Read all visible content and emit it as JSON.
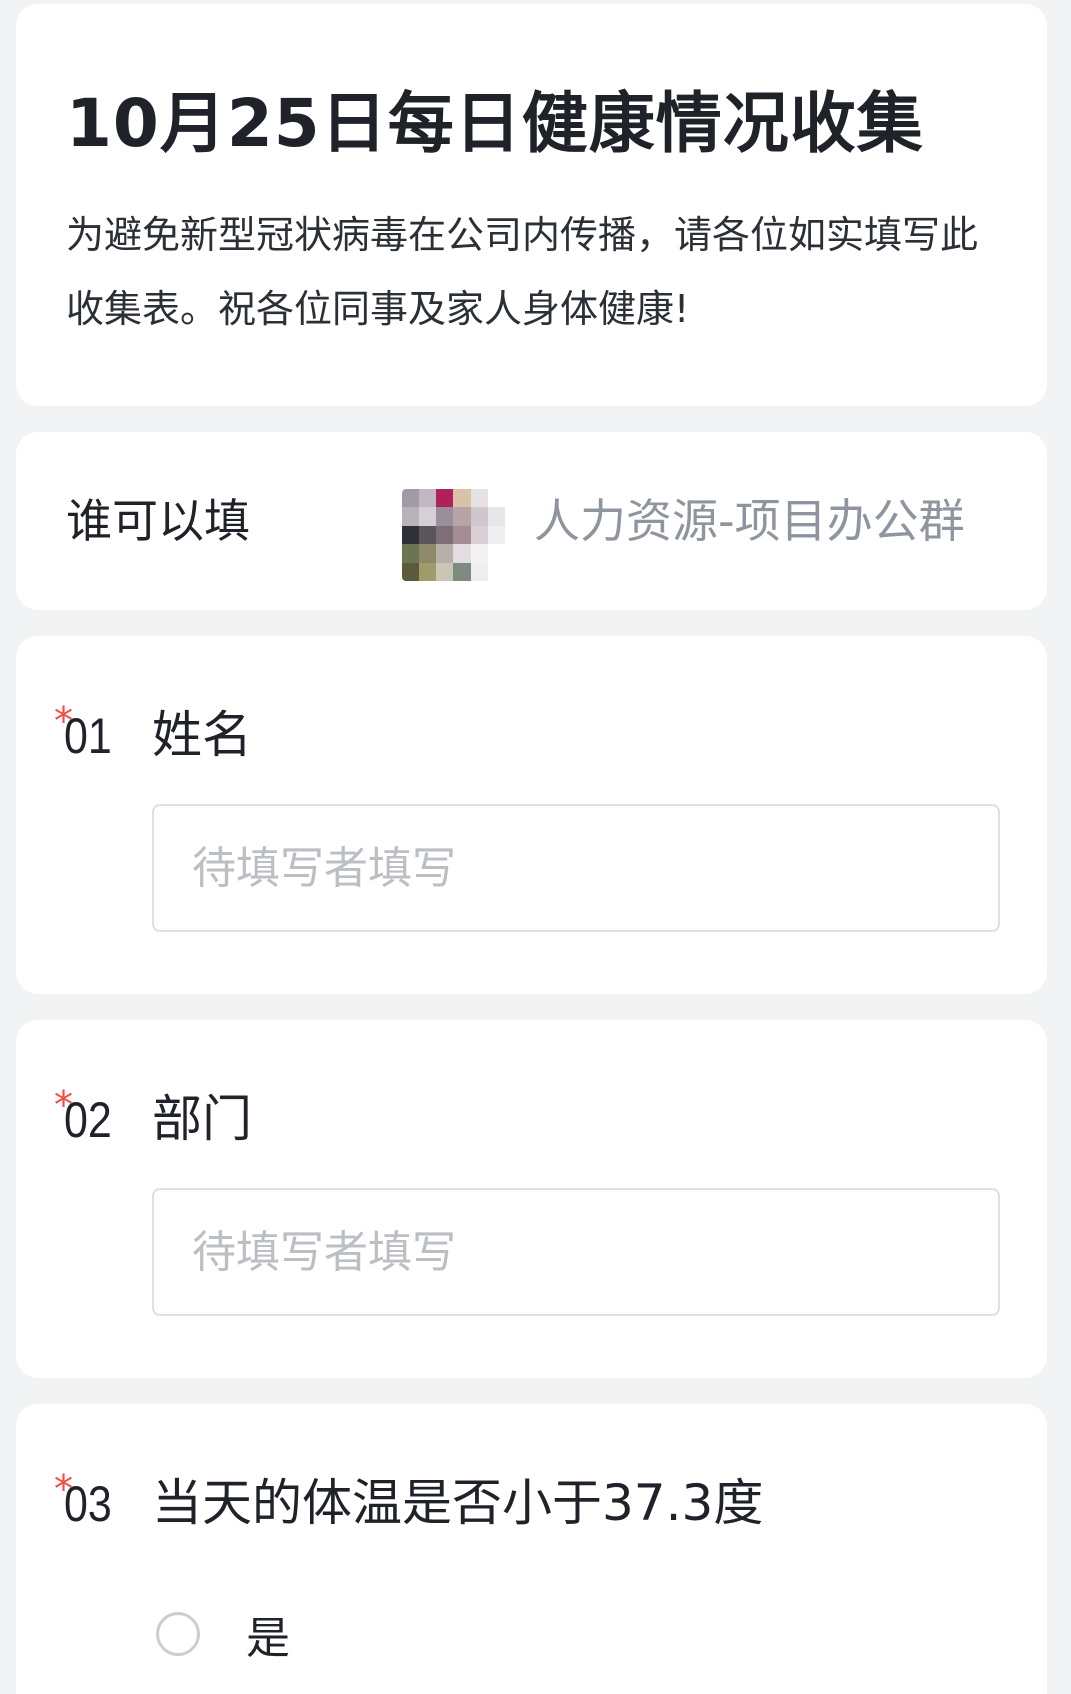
{
  "header": {
    "title": "10月25日每日健康情况收集",
    "description": "为避免新型冠状病毒在公司内传播，请各位如实填写此收集表。祝各位同事及家人身体健康!"
  },
  "audience": {
    "label": "谁可以填",
    "group_name": "人力资源-项目办公群"
  },
  "questions": [
    {
      "required_mark": "*",
      "number": "01",
      "title": "姓名",
      "placeholder": "待填写者填写"
    },
    {
      "required_mark": "*",
      "number": "02",
      "title": "部门",
      "placeholder": "待填写者填写"
    },
    {
      "required_mark": "*",
      "number": "03",
      "title": "当天的体温是否小于37.3度",
      "options": [
        {
          "label": "是"
        }
      ]
    }
  ],
  "colors": {
    "background": "#f2f3f5",
    "required": "#f54a45",
    "muted_text": "#8f959e"
  }
}
